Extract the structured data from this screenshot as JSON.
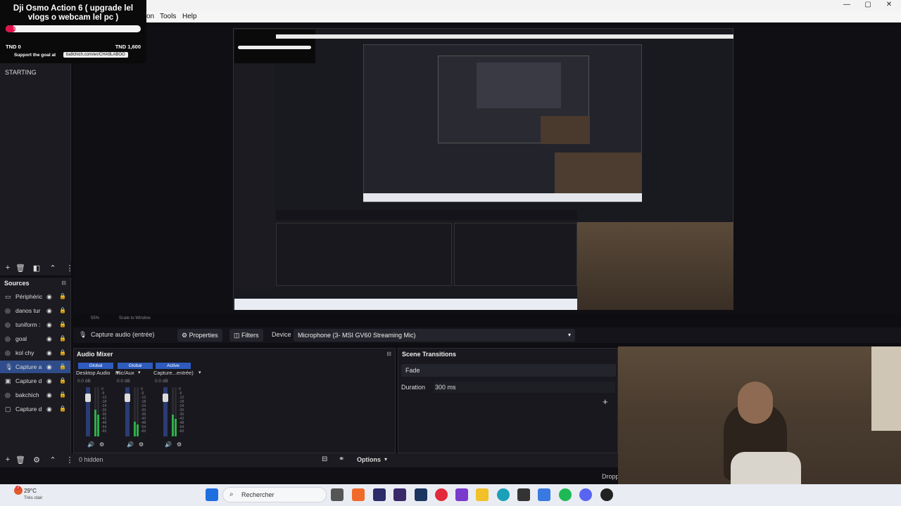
{
  "goal": {
    "title": "Dji Osmo Action 6 ( upgrade lel vlogs o webcam lel pc )",
    "progress_percent": 1,
    "progress_label": "1%",
    "amount_current": "TND 0",
    "amount_target": "TND 1,600",
    "support_text": "Support the goal at",
    "url": "ba9chich.com/en/CHA9LABOO"
  },
  "menu": {
    "partial": "on",
    "tools": "Tools",
    "help": "Help"
  },
  "window_controls": {
    "minimize": "—",
    "maximize": "▢",
    "close": "✕"
  },
  "scenes": {
    "items": [
      "STARTING"
    ]
  },
  "preview": {
    "zoom": "55%",
    "scale_mode": "Scale to Window"
  },
  "source_toolbar": {
    "source_name": "Capture audio (entrée)",
    "properties": "Properties",
    "filters": "Filters",
    "device_label": "Device",
    "device_value": "Microphone (3- MSI GV60 Streaming Mic)"
  },
  "sources": {
    "header": "Sources",
    "items": [
      {
        "name": "Périphéric",
        "icon": "monitor-icon"
      },
      {
        "name": "danos tur",
        "icon": "globe-icon"
      },
      {
        "name": "tuniform :",
        "icon": "globe-icon"
      },
      {
        "name": "goal",
        "icon": "globe-icon"
      },
      {
        "name": "kol chy",
        "icon": "globe-icon"
      },
      {
        "name": "Capture a",
        "icon": "mic-icon",
        "selected": true
      },
      {
        "name": "Capture d",
        "icon": "display-icon"
      },
      {
        "name": "bakchich",
        "icon": "globe-icon"
      },
      {
        "name": "Capture d",
        "icon": "window-icon"
      }
    ]
  },
  "mixer": {
    "title": "Audio Mixer",
    "channels": [
      {
        "badge": "Global",
        "name": "Desktop Audio",
        "db": "0.0 dB",
        "level": 0.55,
        "fader": 0.85
      },
      {
        "badge": "Global",
        "name": "Mic/Aux",
        "db": "0.0 dB",
        "level": 0.3,
        "fader": 0.85
      },
      {
        "badge": "Active",
        "name": "Capture...entrée)",
        "db": "0.0 dB",
        "level": 0.45,
        "fader": 0.85
      }
    ],
    "scale": [
      "0",
      "-6",
      "-12",
      "-18",
      "-24",
      "-30",
      "-36",
      "-42",
      "-48",
      "-54",
      "-60"
    ]
  },
  "transitions": {
    "title": "Scene Transitions",
    "type": "Fade",
    "duration_label": "Duration",
    "duration_value": "300 ms",
    "add": "+"
  },
  "bottombar": {
    "hidden_count": "0 hidden",
    "options": "Options"
  },
  "status": {
    "dropped": "Dropp"
  },
  "taskbar": {
    "weather_temp": "29°C",
    "weather_desc": "Très clair",
    "search_placeholder": "Rechercher",
    "badge_count": "2"
  },
  "colors": {
    "accent": "#2e5bbd",
    "selected_row": "#2f4d8a",
    "goal_fill": "#e0114c"
  }
}
